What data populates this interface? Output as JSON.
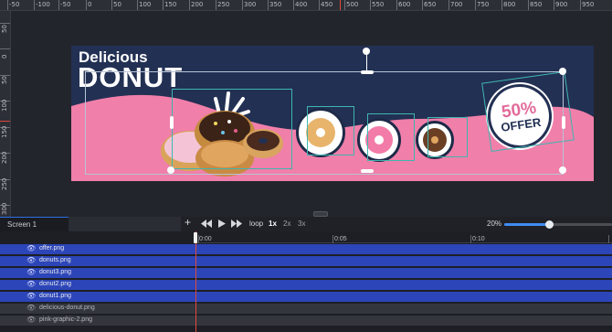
{
  "ruler": {
    "top_labels": [
      "-150",
      "-100",
      "-50",
      "0",
      "50",
      "100",
      "150",
      "200",
      "250",
      "300",
      "350",
      "400",
      "450",
      "500",
      "550",
      "600",
      "650",
      "700",
      "750",
      "800",
      "850",
      "900",
      "950"
    ],
    "left_labels": [
      "50",
      "0",
      "50",
      "100",
      "150",
      "200",
      "250",
      "300"
    ]
  },
  "banner": {
    "title_small": "Delicious",
    "title_big": "DONUT",
    "offer_percent": "50%",
    "offer_label": "OFFER",
    "pink_color": "#f07fa9",
    "navy_color": "#223053"
  },
  "toolbar": {
    "screen_tab": "Screen 1",
    "add_icon": "plus-icon",
    "rewind_icon": "rewind-icon",
    "play_icon": "play-icon",
    "forward_icon": "fast-forward-icon",
    "loop_label": "loop",
    "speed_1x": "1x",
    "speed_2x": "2x",
    "speed_3x": "3x",
    "zoom_label": "20%",
    "zoom_value": 0.2
  },
  "timeline": {
    "time_labels": [
      "0:00",
      "0:05",
      "0:10"
    ],
    "layers": [
      {
        "name": "offer.png",
        "selected": true
      },
      {
        "name": "donuts.png",
        "selected": true
      },
      {
        "name": "donut3.png",
        "selected": true
      },
      {
        "name": "donut2.png",
        "selected": true
      },
      {
        "name": "donut1.png",
        "selected": true
      },
      {
        "name": "delicious-donut.png",
        "selected": false
      },
      {
        "name": "pink-graphic-2.png",
        "selected": false
      }
    ]
  }
}
